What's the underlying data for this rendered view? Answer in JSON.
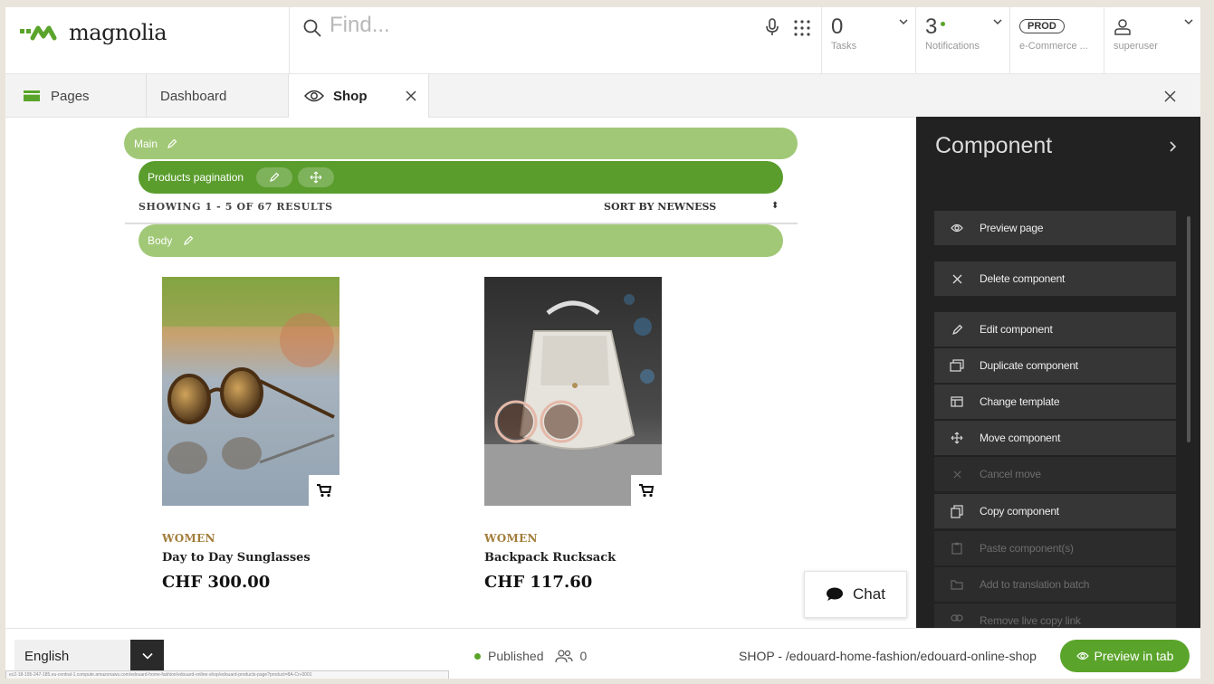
{
  "header": {
    "logo_text": "magnolia",
    "search_placeholder": "Find...",
    "tasks": {
      "count": "0",
      "label": "Tasks"
    },
    "notifications": {
      "count": "3",
      "label": "Notifications"
    },
    "environment": {
      "badge": "PROD",
      "label": "e-Commerce ..."
    },
    "user": {
      "label": "superuser"
    }
  },
  "tabs": [
    {
      "label": "Pages"
    },
    {
      "label": "Dashboard"
    },
    {
      "label": "Shop"
    }
  ],
  "page": {
    "main_bar": "Main",
    "pagination_bar": "Products pagination",
    "showing": "SHOWING 1 - 5 OF 67 RESULTS",
    "sort": "SORT BY NEWNESS",
    "body_bar": "Body",
    "products": [
      {
        "category": "WOMEN",
        "name": "Day to Day Sunglasses",
        "price": "CHF 300.00"
      },
      {
        "category": "WOMEN",
        "name": "Backpack Rucksack",
        "price": "CHF 117.60"
      }
    ],
    "chat_label": "Chat"
  },
  "panel": {
    "title": "Component",
    "actions": [
      {
        "label": "Preview page",
        "icon": "eye-icon",
        "enabled": true
      },
      {
        "label": "Delete component",
        "icon": "close-icon",
        "enabled": true
      },
      {
        "label": "Edit component",
        "icon": "pencil-icon",
        "enabled": true
      },
      {
        "label": "Duplicate component",
        "icon": "duplicate-icon",
        "enabled": true
      },
      {
        "label": "Change template",
        "icon": "template-icon",
        "enabled": true
      },
      {
        "label": "Move component",
        "icon": "move-icon",
        "enabled": true
      },
      {
        "label": "Cancel move",
        "icon": "close-icon",
        "enabled": false
      },
      {
        "label": "Copy component",
        "icon": "copy-icon",
        "enabled": true
      },
      {
        "label": "Paste component(s)",
        "icon": "paste-icon",
        "enabled": false
      },
      {
        "label": "Add to translation batch",
        "icon": "folder-icon",
        "enabled": false
      },
      {
        "label": "Remove live copy link",
        "icon": "link-icon",
        "enabled": false
      }
    ]
  },
  "footer": {
    "language": "English",
    "status": "Published",
    "users_count": "0",
    "path": "SHOP - /edouard-home-fashion/edouard-online-shop",
    "preview_label": "Preview in tab",
    "url": "ec2-18-195-247-185.eu-central-1.compute.amazonaws.com/edouard-home-fashion/edouard-online-shop/edouard-products-page?product=8A-Cn-0001"
  },
  "colors": {
    "accent": "#5aa42b",
    "bar_light": "#a1c877",
    "bar_dark": "#5a9d2d",
    "panel_bg": "#222222",
    "category": "#a27d3b"
  }
}
